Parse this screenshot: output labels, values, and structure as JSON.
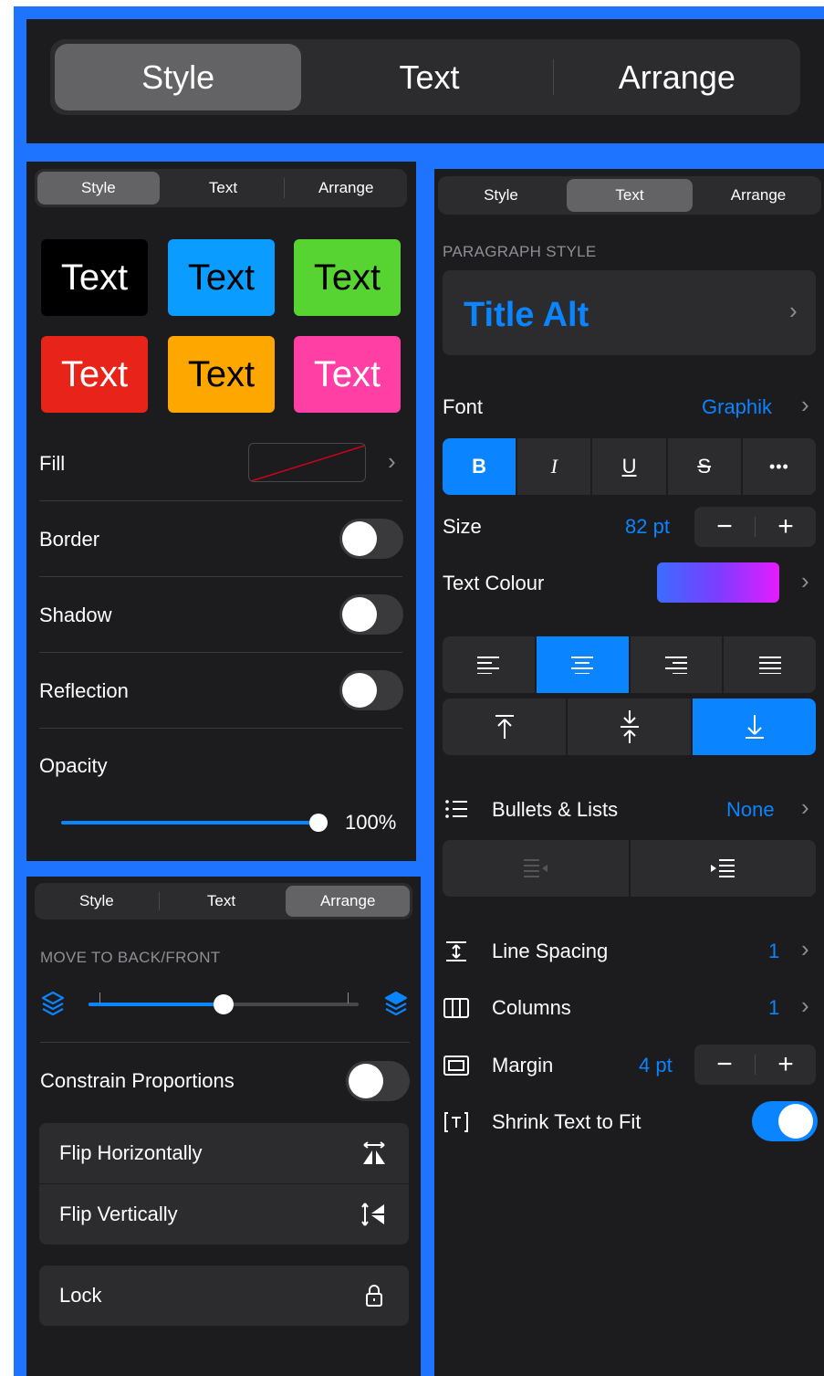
{
  "top_segment": {
    "options": [
      "Style",
      "Text",
      "Arrange"
    ],
    "selected": "Style"
  },
  "style_panel": {
    "tabs": [
      "Style",
      "Text",
      "Arrange"
    ],
    "presets": [
      {
        "label": "Text",
        "bg": "#000000",
        "fg": "#ffffff"
      },
      {
        "label": "Text",
        "bg": "#0a9cff",
        "fg": "#000000"
      },
      {
        "label": "Text",
        "bg": "#57d432",
        "fg": "#000000"
      },
      {
        "label": "Text",
        "bg": "#e8231a",
        "fg": "#ffffff"
      },
      {
        "label": "Text",
        "bg": "#fda700",
        "fg": "#000000"
      },
      {
        "label": "Text",
        "bg": "#ff3fa4",
        "fg": "#ffffff"
      }
    ],
    "fill_label": "Fill",
    "border_label": "Border",
    "shadow_label": "Shadow",
    "reflection_label": "Reflection",
    "opacity_label": "Opacity",
    "opacity_value": "100%",
    "opacity_fraction": 1.0
  },
  "arrange_panel": {
    "tabs": [
      "Style",
      "Text",
      "Arrange"
    ],
    "section_title": "MOVE TO BACK/FRONT",
    "layer_fraction": 0.5,
    "constrain_label": "Constrain Proportions",
    "flip_h_label": "Flip Horizontally",
    "flip_v_label": "Flip Vertically",
    "lock_label": "Lock"
  },
  "text_panel": {
    "tabs": [
      "Style",
      "Text",
      "Arrange"
    ],
    "paragraph_style_title": "PARAGRAPH STYLE",
    "paragraph_style": "Title Alt",
    "font_label": "Font",
    "font_value": "Graphik",
    "format_buttons": [
      "B",
      "I",
      "U",
      "S",
      "•••"
    ],
    "size_label": "Size",
    "size_value": "82 pt",
    "text_colour_label": "Text Colour",
    "bullets_label": "Bullets & Lists",
    "bullets_value": "None",
    "line_spacing_label": "Line Spacing",
    "line_spacing_value": "1",
    "columns_label": "Columns",
    "columns_value": "1",
    "margin_label": "Margin",
    "margin_value": "4 pt",
    "shrink_label": "Shrink Text to Fit",
    "stepper_minus": "−",
    "stepper_plus": "+"
  },
  "colors": {
    "accent": "#0a84ff",
    "highlight_border": "#1f74ff"
  }
}
